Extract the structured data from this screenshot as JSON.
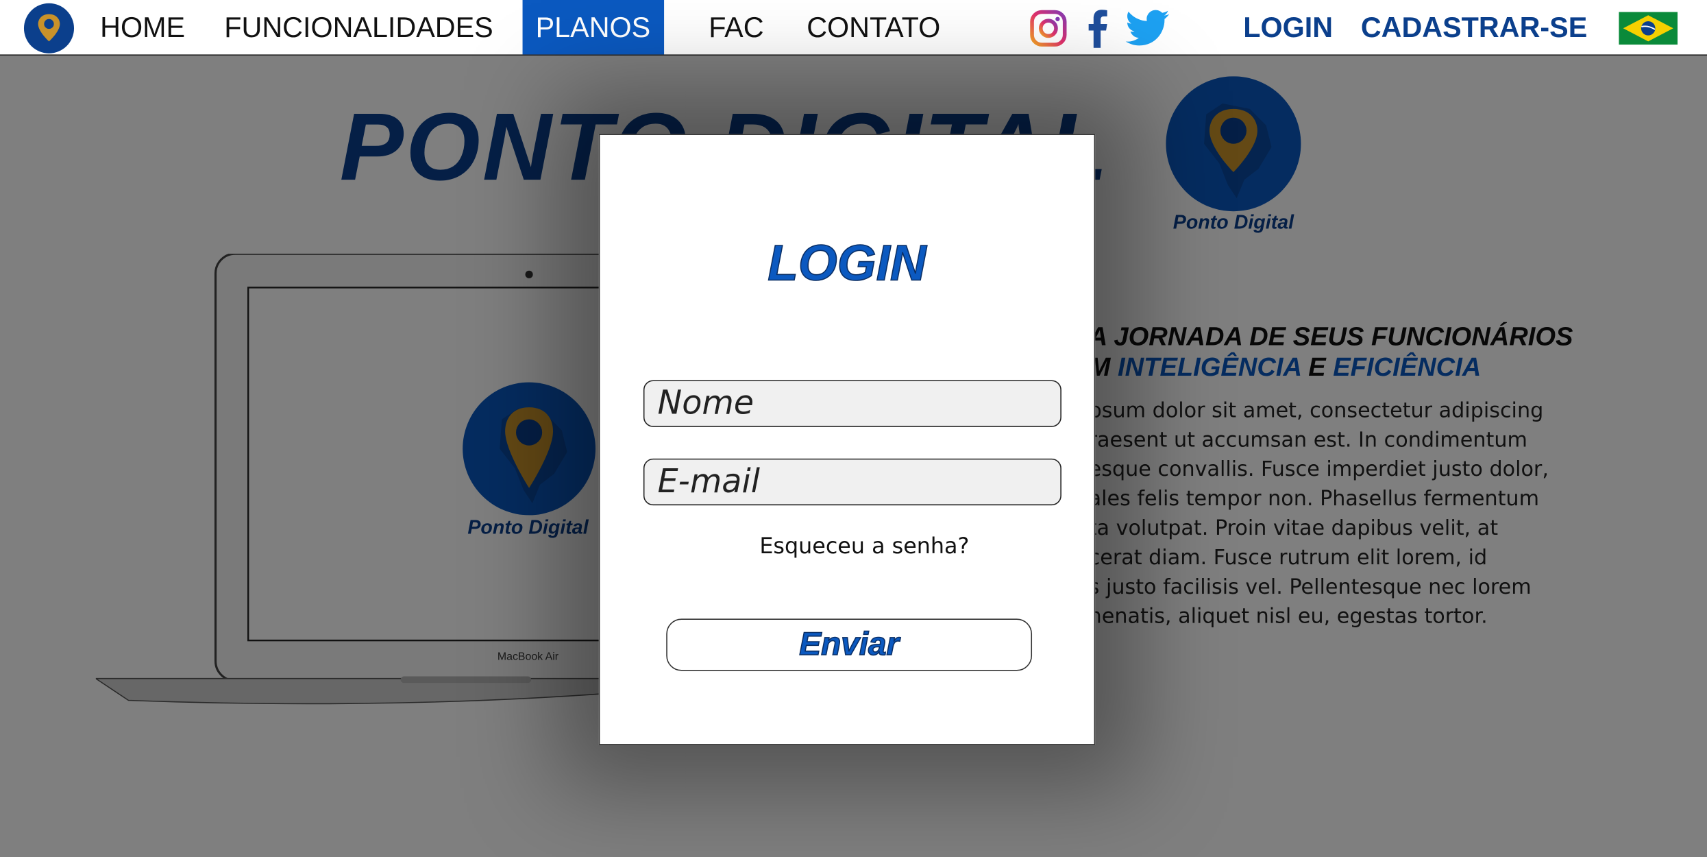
{
  "nav": {
    "links": [
      "HOME",
      "FUNCIONALIDADES",
      "PLANOS",
      "FAC",
      "CONTATO"
    ],
    "active": "PLANOS",
    "login": "LOGIN",
    "signup": "CADASTRAR-SE",
    "social_icons": [
      "instagram-icon",
      "facebook-icon",
      "twitter-icon"
    ],
    "language_icon": "brazil-flag-icon"
  },
  "hero": {
    "title": "PONTO DIGITAL",
    "badge_text": "Ponto Digital",
    "screen_logo_text": "Ponto Digital",
    "laptop_label": "MacBook Air",
    "headline_line1": "A JORNADA DE SEUS FUNCIONÁRIOS",
    "headline_line2_prefix": "M ",
    "headline_line2_blue1": "INTELIGÊNCIA",
    "headline_line2_mid": " E ",
    "headline_line2_blue2": "EFICIÊNCIA",
    "body_lines": [
      "psum dolor sit amet, consectetur adipiscing",
      "raesent ut accumsan est. In condimentum",
      "esque convallis. Fusce imperdiet justo dolor,",
      "ales felis tempor non. Phasellus fermentum",
      "ta volutpat. Proin vitae dapibus velit, at",
      "cerat diam. Fusce rutrum elit lorem, id",
      "s justo facilisis vel. Pellentesque nec lorem",
      "nenatis, aliquet nisl eu, egestas tortor."
    ]
  },
  "modal": {
    "title": "LOGIN",
    "name_placeholder": "Nome",
    "email_placeholder": "E-mail",
    "forgot": "Esqueceu a senha?",
    "submit": "Enviar"
  },
  "colors": {
    "brand_blue": "#0b59c0",
    "brand_dark_blue": "#0b3f8c",
    "pin_gold": "#c9922a"
  }
}
